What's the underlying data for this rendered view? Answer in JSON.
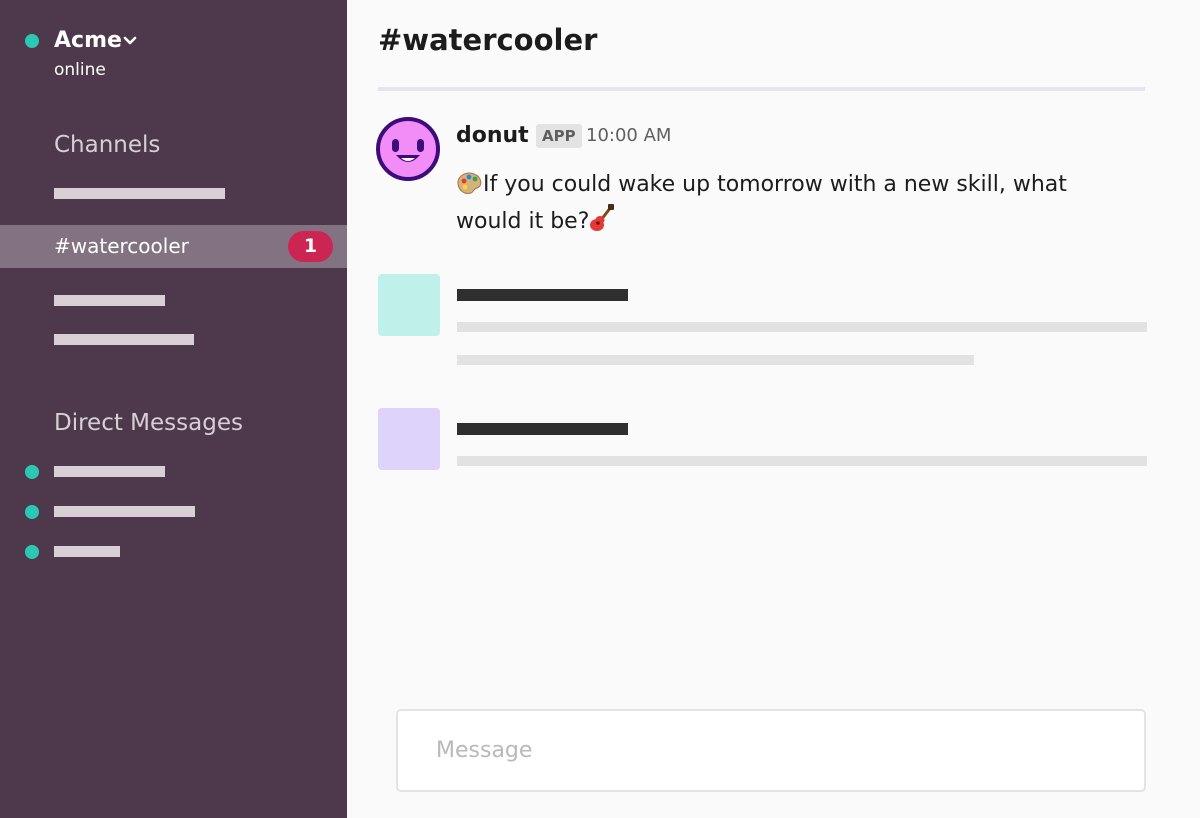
{
  "workspace": {
    "name": "Acme",
    "status": "online",
    "status_color": "#2bc9b4",
    "switcher_icon": "chevron-down-icon"
  },
  "sidebar": {
    "background": "#4d394b",
    "channels_title": "Channels",
    "active_channel": {
      "label": "#watercooler",
      "unread_count": "1"
    },
    "dms_title": "Direct Messages",
    "dm_presence": [
      "online",
      "online",
      "online"
    ]
  },
  "channel": {
    "title": "#watercooler"
  },
  "messages": [
    {
      "author": "donut",
      "badge": "APP",
      "time": "10:00 AM",
      "avatar_icon": "smiling-donut-bot-icon",
      "emoji_before": "palette-emoji-icon",
      "text": "If you could wake up tomorrow with a new skill, what would it be?",
      "emoji_after": "guitar-emoji-icon"
    }
  ],
  "placeholder_messages": [
    {
      "avatar_color": "#bff0ea"
    },
    {
      "avatar_color": "#ddd3fb"
    }
  ],
  "composer": {
    "placeholder": "Message"
  },
  "colors": {
    "accent_badge": "#cd2553",
    "active_item": "#837282"
  }
}
